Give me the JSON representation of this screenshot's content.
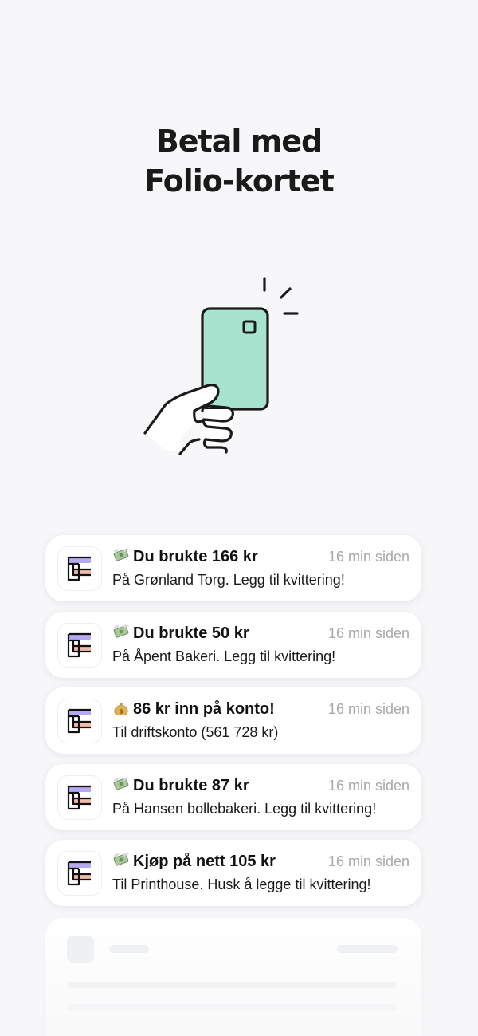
{
  "title": {
    "line1": "Betal med",
    "line2": "Folio-kortet"
  },
  "illustration": {
    "icon": "hand-holding-card-icon",
    "card_color": "#a6e4cf",
    "stroke_color": "#1a1a1a"
  },
  "notifications": [
    {
      "emoji": "money-with-wings-icon",
      "title": "Du brukte 166 kr",
      "time": "16 min siden",
      "body": "På Grønland Torg. Legg til kvittering!"
    },
    {
      "emoji": "money-with-wings-icon",
      "title": "Du brukte 50 kr",
      "time": "16 min siden",
      "body": "På Åpent Bakeri. Legg til kvittering!"
    },
    {
      "emoji": "money-bag-icon",
      "title": "86 kr inn på konto!",
      "time": "16 min siden",
      "body": "Til driftskonto (561 728 kr)"
    },
    {
      "emoji": "money-with-wings-icon",
      "title": "Du brukte 87 kr",
      "time": "16 min siden",
      "body": "På Hansen bollebakeri. Legg til kvittering!"
    },
    {
      "emoji": "money-with-wings-icon",
      "title": "Kjøp på nett 105 kr",
      "time": "16 min siden",
      "body": "Til Printhouse. Husk å legge til kvittering!"
    }
  ],
  "app_icon": {
    "name": "folio-logo-icon",
    "purple": "#b7a8f0",
    "pink": "#f3b9ad"
  }
}
